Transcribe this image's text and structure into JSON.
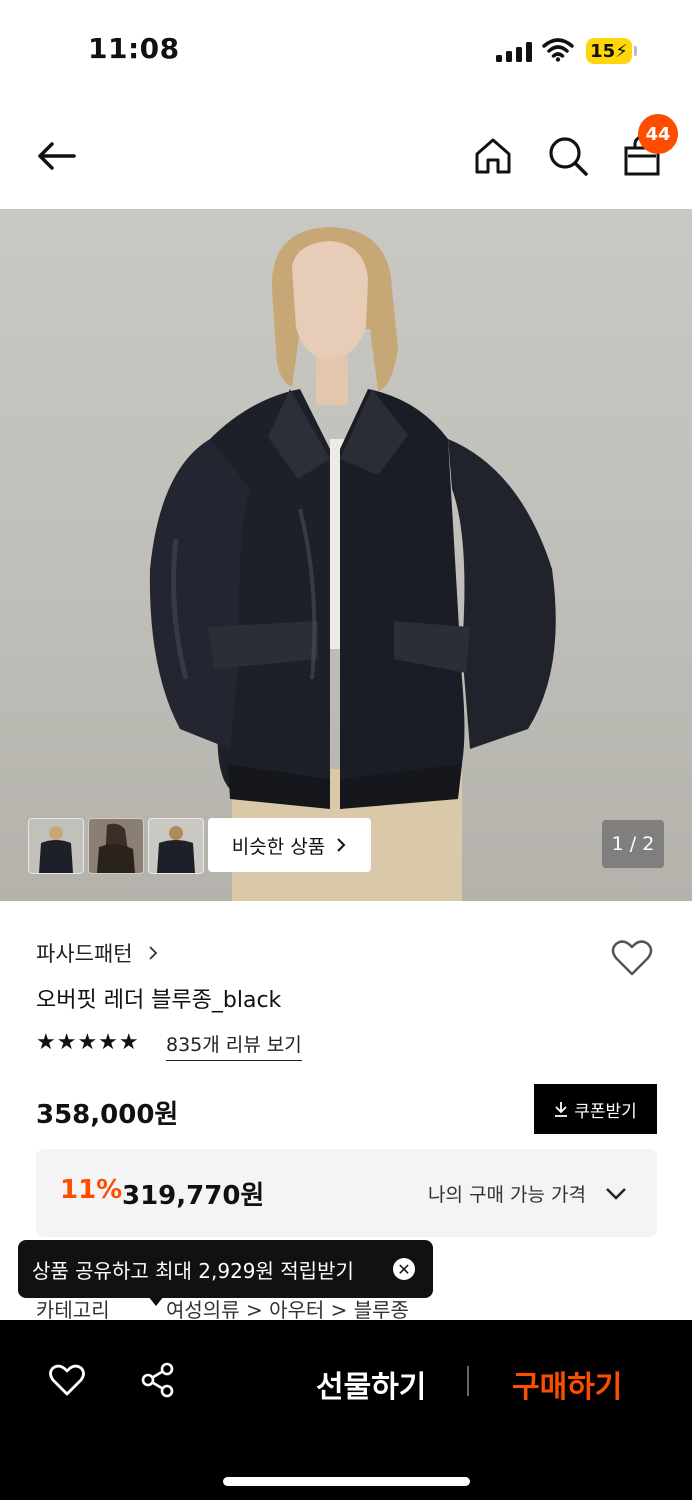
{
  "status": {
    "time": "11:08",
    "battery": "15"
  },
  "nav": {
    "cart_count": "44"
  },
  "gallery": {
    "similar_label": "비슷한 상품",
    "pager": "1 / 2"
  },
  "product": {
    "brand": "파사드패턴",
    "name": "오버핏 레더 블루종_black",
    "rating_stars": "★★★★★",
    "review_link": "835개 리뷰 보기",
    "price": "358,000원",
    "coupon_label": "쿠폰받기",
    "discount_rate": "11%",
    "discount_price": "319,770원",
    "my_price_label": "나의 구매 가능 가격",
    "category_label": "카테고리",
    "category_path": "여성의류 > 아우터 > 블루종"
  },
  "tooltip": {
    "text": "상품 공유하고 최대 2,929원 적립받기"
  },
  "bottom": {
    "gift_label": "선물하기",
    "buy_label": "구매하기"
  },
  "colors": {
    "accent": "#ff4d00",
    "battery": "#ffd60a"
  }
}
